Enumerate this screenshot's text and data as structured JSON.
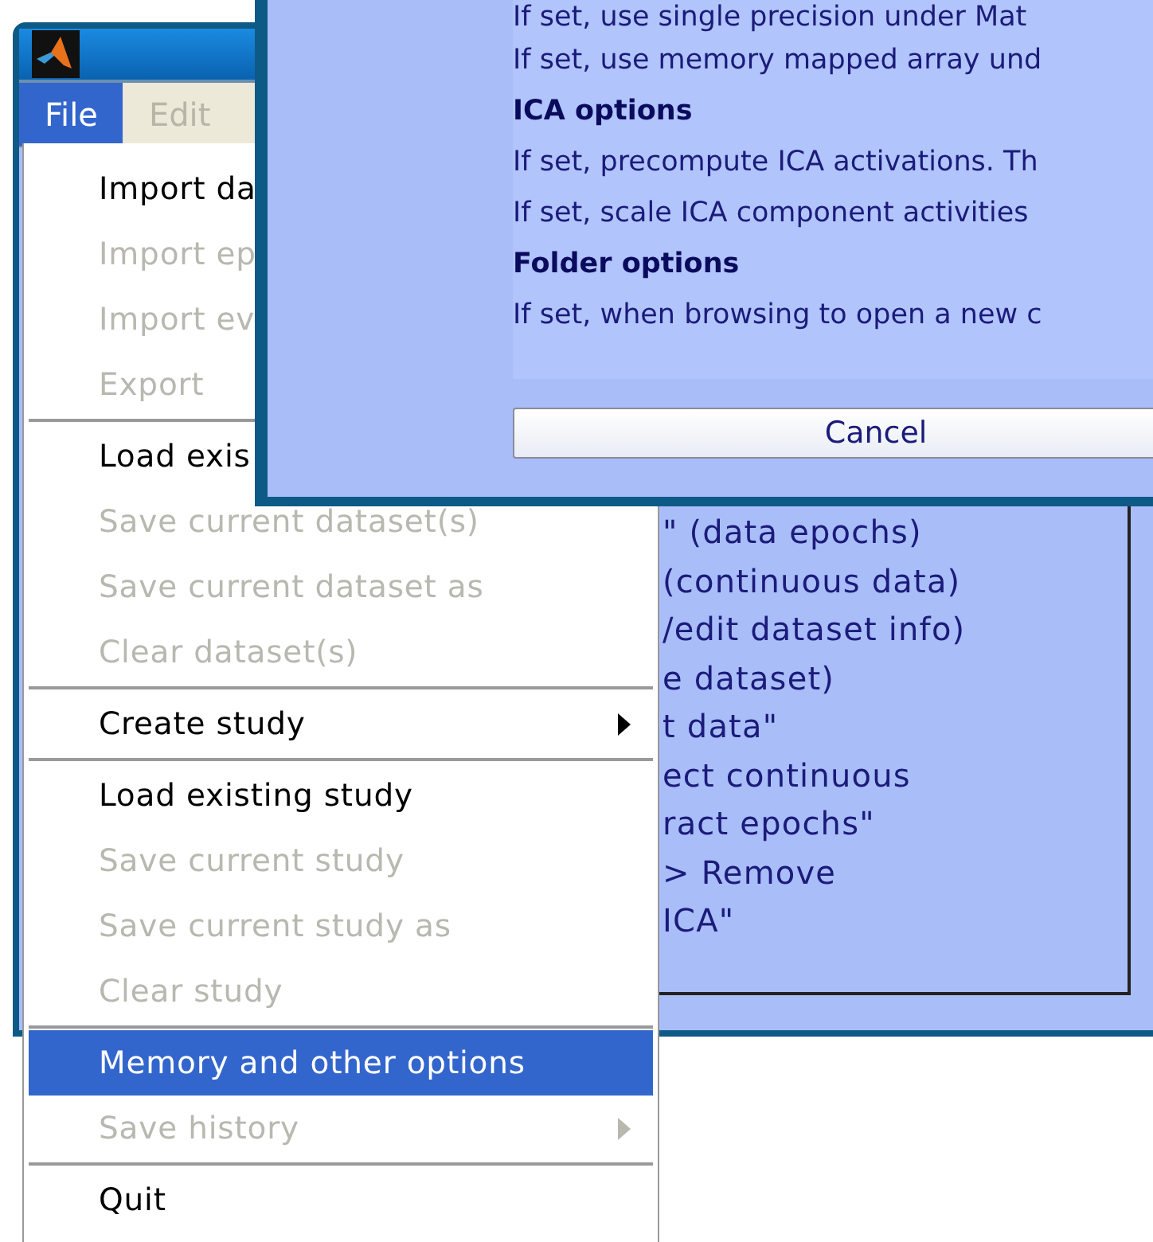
{
  "main_window": {
    "menu_bar": [
      {
        "label": "File",
        "selected": true,
        "disabled": false
      },
      {
        "label": "Edit",
        "selected": false,
        "disabled": true
      }
    ],
    "content_lines": [
      "\" (data epochs)",
      "(continuous data)",
      "/edit dataset info)",
      "e dataset)",
      "t data\"",
      "ect continuous",
      "ract epochs\"",
      "> Remove",
      "ICA\""
    ]
  },
  "file_menu": {
    "items": [
      {
        "kind": "item",
        "label": "Import da",
        "disabled": false,
        "selected": false
      },
      {
        "kind": "item",
        "label": "Import ep",
        "disabled": true,
        "selected": false
      },
      {
        "kind": "item",
        "label": "Import ev",
        "disabled": true,
        "selected": false
      },
      {
        "kind": "item",
        "label": "Export",
        "disabled": true,
        "selected": false
      },
      {
        "kind": "separator"
      },
      {
        "kind": "item",
        "label": "Load exis",
        "disabled": false,
        "selected": false
      },
      {
        "kind": "item",
        "label": "Save current dataset(s)",
        "disabled": true,
        "selected": false,
        "submenu": false
      },
      {
        "kind": "item",
        "label": "Save current dataset as",
        "disabled": true,
        "selected": false,
        "submenu": false
      },
      {
        "kind": "item",
        "label": "Clear dataset(s)",
        "disabled": true,
        "selected": false,
        "submenu": false
      },
      {
        "kind": "separator"
      },
      {
        "kind": "item",
        "label": "Create study",
        "disabled": false,
        "selected": false,
        "submenu": true
      },
      {
        "kind": "separator"
      },
      {
        "kind": "item",
        "label": "Load existing study",
        "disabled": false,
        "selected": false,
        "submenu": false
      },
      {
        "kind": "item",
        "label": "Save current study",
        "disabled": true,
        "selected": false,
        "submenu": false
      },
      {
        "kind": "item",
        "label": "Save current study as",
        "disabled": true,
        "selected": false,
        "submenu": false
      },
      {
        "kind": "item",
        "label": "Clear study",
        "disabled": true,
        "selected": false,
        "submenu": false
      },
      {
        "kind": "separator"
      },
      {
        "kind": "item",
        "label": "Memory and other options",
        "disabled": false,
        "selected": true,
        "submenu": false
      },
      {
        "kind": "item",
        "label": "Save history",
        "disabled": true,
        "selected": false,
        "submenu": true
      },
      {
        "kind": "separator"
      },
      {
        "kind": "item",
        "label": "Quit",
        "disabled": false,
        "selected": false,
        "submenu": false
      }
    ]
  },
  "options_dialog": {
    "lines": [
      {
        "kind": "text",
        "text": "If set, use single precision under Mat"
      },
      {
        "kind": "text",
        "text": "If set, use memory mapped array und"
      },
      {
        "kind": "heading",
        "text": "ICA options"
      },
      {
        "kind": "text",
        "text": "If set, precompute ICA activations. Th"
      },
      {
        "kind": "text",
        "text": "If set, scale ICA component activities"
      },
      {
        "kind": "heading",
        "text": "Folder options"
      },
      {
        "kind": "text",
        "text": "If set, when browsing to open a new c"
      }
    ],
    "cancel_button": "Cancel"
  }
}
